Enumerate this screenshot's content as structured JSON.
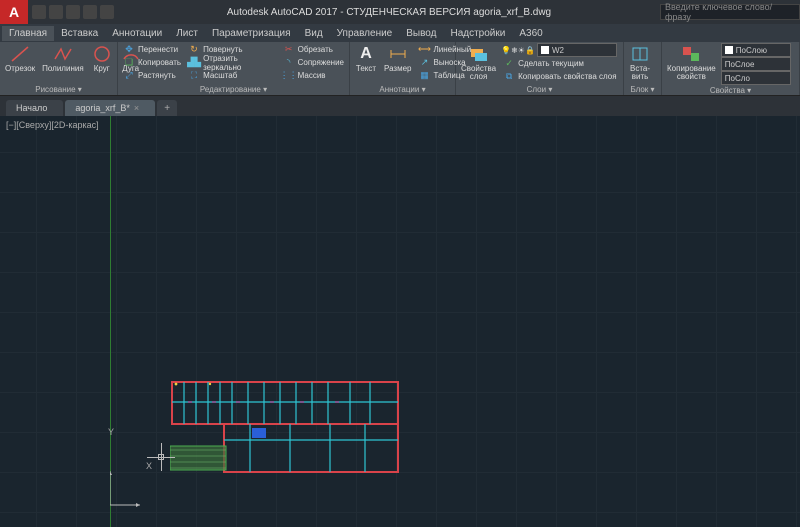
{
  "title": "Autodesk AutoCAD 2017 - СТУДЕНЧЕСКАЯ ВЕРСИЯ   agoria_xrf_B.dwg",
  "search_placeholder": "Введите ключевое слово/фразу",
  "tabs": {
    "main": "Главная",
    "insert": "Вставка",
    "annotate": "Аннотации",
    "layout": "Лист",
    "parametric": "Параметризация",
    "view": "Вид",
    "manage": "Управление",
    "output": "Вывод",
    "addins": "Надстройки",
    "a360": "A360"
  },
  "panels": {
    "draw": {
      "title": "Рисование ▾",
      "line": "Отрезок",
      "polyline": "Полилиния",
      "circle": "Круг",
      "arc": "Дуга"
    },
    "modify": {
      "title": "Редактирование ▾",
      "move": "Перенести",
      "copy": "Копировать",
      "stretch": "Растянуть",
      "rotate": "Повернуть",
      "mirror": "Отразить зеркально",
      "scale": "Масштаб",
      "trim": "Обрезать",
      "fillet": "Сопряжение",
      "array": "Массив"
    },
    "annotation": {
      "title": "Аннотации ▾",
      "text": "Текст",
      "dim": "Размер",
      "linear": "Линейный",
      "leader": "Выноска",
      "table": "Таблица"
    },
    "layers": {
      "title": "Слои ▾",
      "props": "Свойства\nслоя",
      "combo": "W2",
      "makecurr": "Сделать текущим",
      "matchlyr": "Копировать свойства слоя"
    },
    "block": {
      "title": "Блок ▾",
      "insert": "Вста-\nвить"
    },
    "props": {
      "title": "Свойства ▾",
      "match": "Копирование\nсвойств",
      "bylayer1": "ПоСлою",
      "bylayer2": "ПоСлое",
      "bylayer3": "ПоСло"
    }
  },
  "file_tabs": {
    "start": "Начало",
    "doc": "agoria_xrf_B*"
  },
  "view_cube": "[−][Сверху][2D-каркас]",
  "ucs": {
    "x": "X",
    "y": "Y"
  }
}
